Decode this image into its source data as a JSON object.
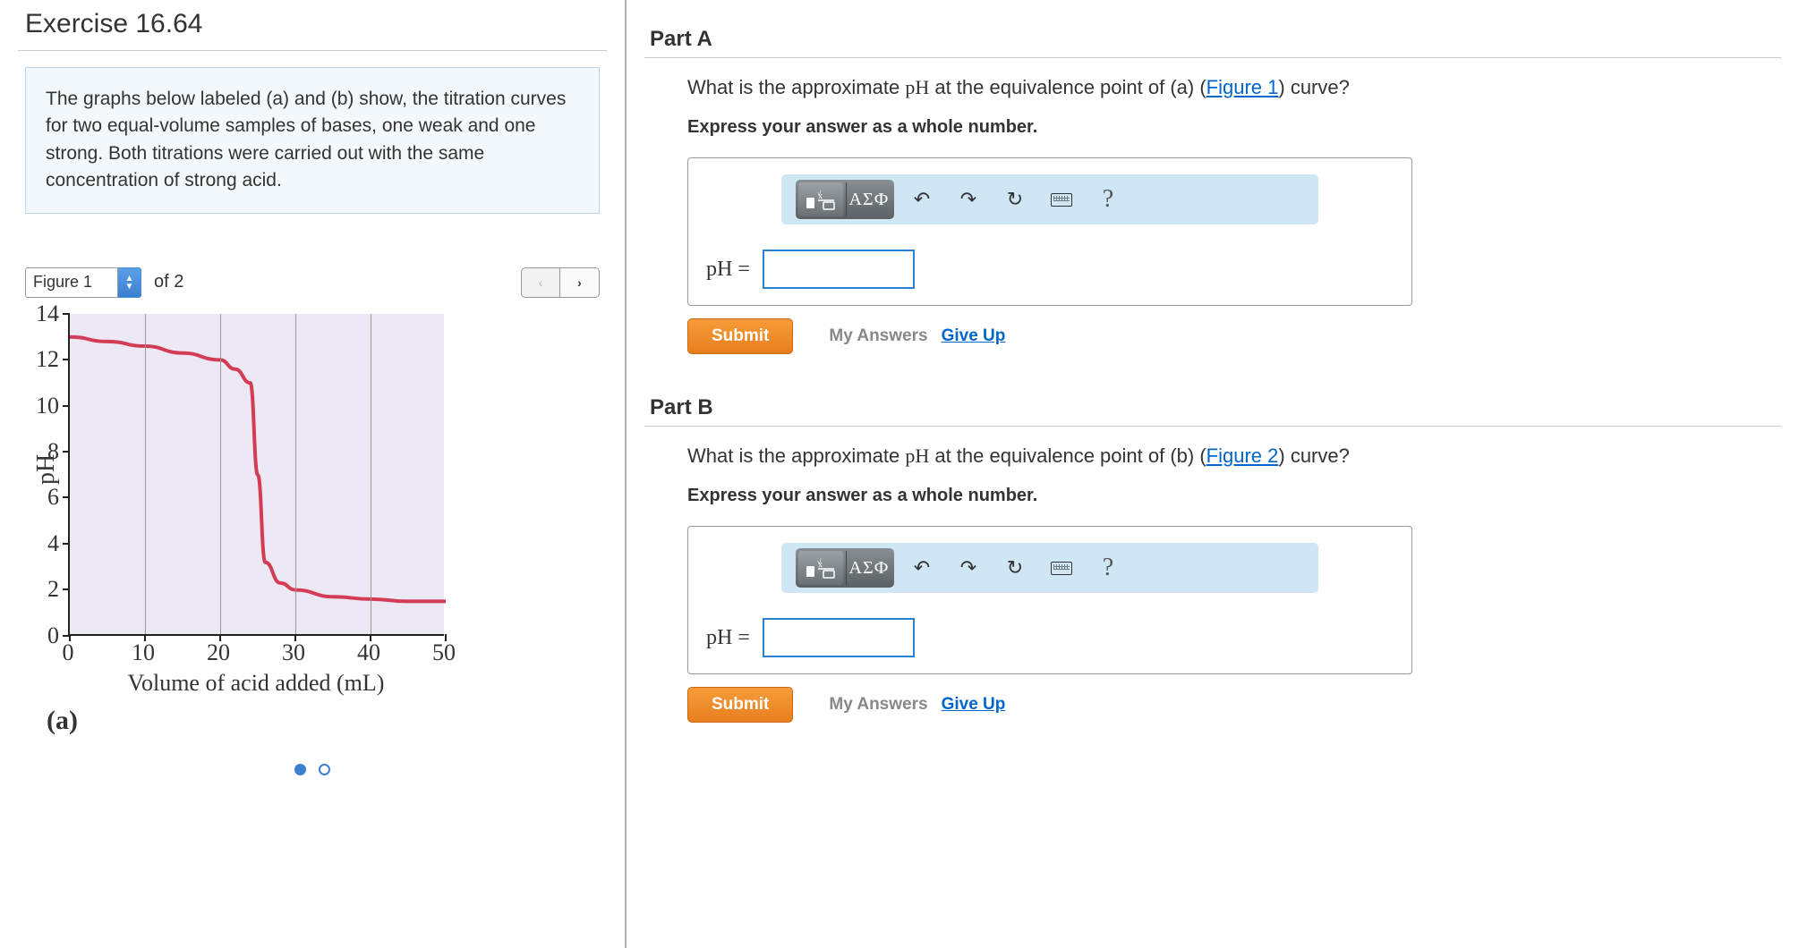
{
  "exercise": {
    "title": "Exercise 16.64"
  },
  "description": "The graphs below labeled (a) and (b) show, the titration curves for two equal-volume samples of bases, one weak and one strong. Both titrations were carried out with the same concentration of strong acid.",
  "figure_nav": {
    "selected": "Figure 1",
    "of_label": "of 2",
    "prev": "‹",
    "next": "›"
  },
  "chart_data": {
    "type": "line",
    "title": "",
    "xlabel": "Volume of acid added (mL)",
    "ylabel": "pH",
    "xlim": [
      0,
      50
    ],
    "ylim": [
      0,
      14
    ],
    "x_ticks": [
      0,
      10,
      20,
      30,
      40,
      50
    ],
    "y_ticks": [
      0,
      2,
      4,
      6,
      8,
      10,
      12,
      14
    ],
    "series": [
      {
        "name": "(a)",
        "color": "#d43b55",
        "x": [
          0,
          5,
          10,
          15,
          20,
          22,
          24,
          25,
          26,
          28,
          30,
          35,
          40,
          45,
          50
        ],
        "y": [
          13.0,
          12.8,
          12.6,
          12.3,
          12.0,
          11.6,
          11.0,
          7.0,
          3.2,
          2.3,
          2.0,
          1.7,
          1.6,
          1.5,
          1.5
        ]
      }
    ],
    "figure_label": "(a)"
  },
  "pager": {
    "total": 2,
    "active": 1
  },
  "toolbar": {
    "template_btn": "template",
    "greek_btn": "ΑΣФ",
    "undo": "↶",
    "redo": "↷",
    "reset": "↻",
    "keyboard": "kbd",
    "help": "?"
  },
  "parts": {
    "A": {
      "title": "Part A",
      "question_pre": "What is the approximate ",
      "question_ph": "pH",
      "question_mid": " at the equivalence point of (a) (",
      "figlink": "Figure 1",
      "question_post": ") curve?",
      "instruction": "Express your answer as a whole number.",
      "answer_label": "pH =",
      "submit": "Submit",
      "my_answers": "My Answers",
      "give_up": "Give Up"
    },
    "B": {
      "title": "Part B",
      "question_pre": "What is the approximate ",
      "question_ph": "pH",
      "question_mid": " at the equivalence point of (b) (",
      "figlink": "Figure 2",
      "question_post": ") curve?",
      "instruction": "Express your answer as a whole number.",
      "answer_label": "pH =",
      "submit": "Submit",
      "my_answers": "My Answers",
      "give_up": "Give Up"
    }
  }
}
